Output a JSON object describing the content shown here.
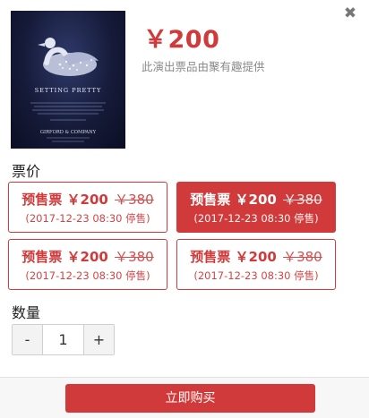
{
  "header": {
    "close_icon": "close-icon",
    "price": "￥200",
    "provider_note": "此演出票品由聚有趣提供"
  },
  "poster": {
    "title": "SETTING PRETTY",
    "brand": "GIRFORD & COMPANY"
  },
  "tickets_section": {
    "label": "票价",
    "tickets": [
      {
        "type": "预售票",
        "price": "￥200",
        "original": "￥380",
        "note": "(2017-12-23 08:30 停售)",
        "selected": false
      },
      {
        "type": "预售票",
        "price": "￥200",
        "original": "￥380",
        "note": "(2017-12-23 08:30 停售)",
        "selected": true
      },
      {
        "type": "预售票",
        "price": "￥200",
        "original": "￥380",
        "note": "(2017-12-23 08:30 停售)",
        "selected": false
      },
      {
        "type": "预售票",
        "price": "￥200",
        "original": "￥380",
        "note": "(2017-12-23 08:30 停售)",
        "selected": false
      }
    ]
  },
  "quantity_section": {
    "label": "数量",
    "minus": "-",
    "value": "1",
    "plus": "+"
  },
  "footer": {
    "buy_label": "立即购买"
  },
  "colors": {
    "accent": "#d03a3a",
    "muted_text": "#8a8a8a"
  }
}
